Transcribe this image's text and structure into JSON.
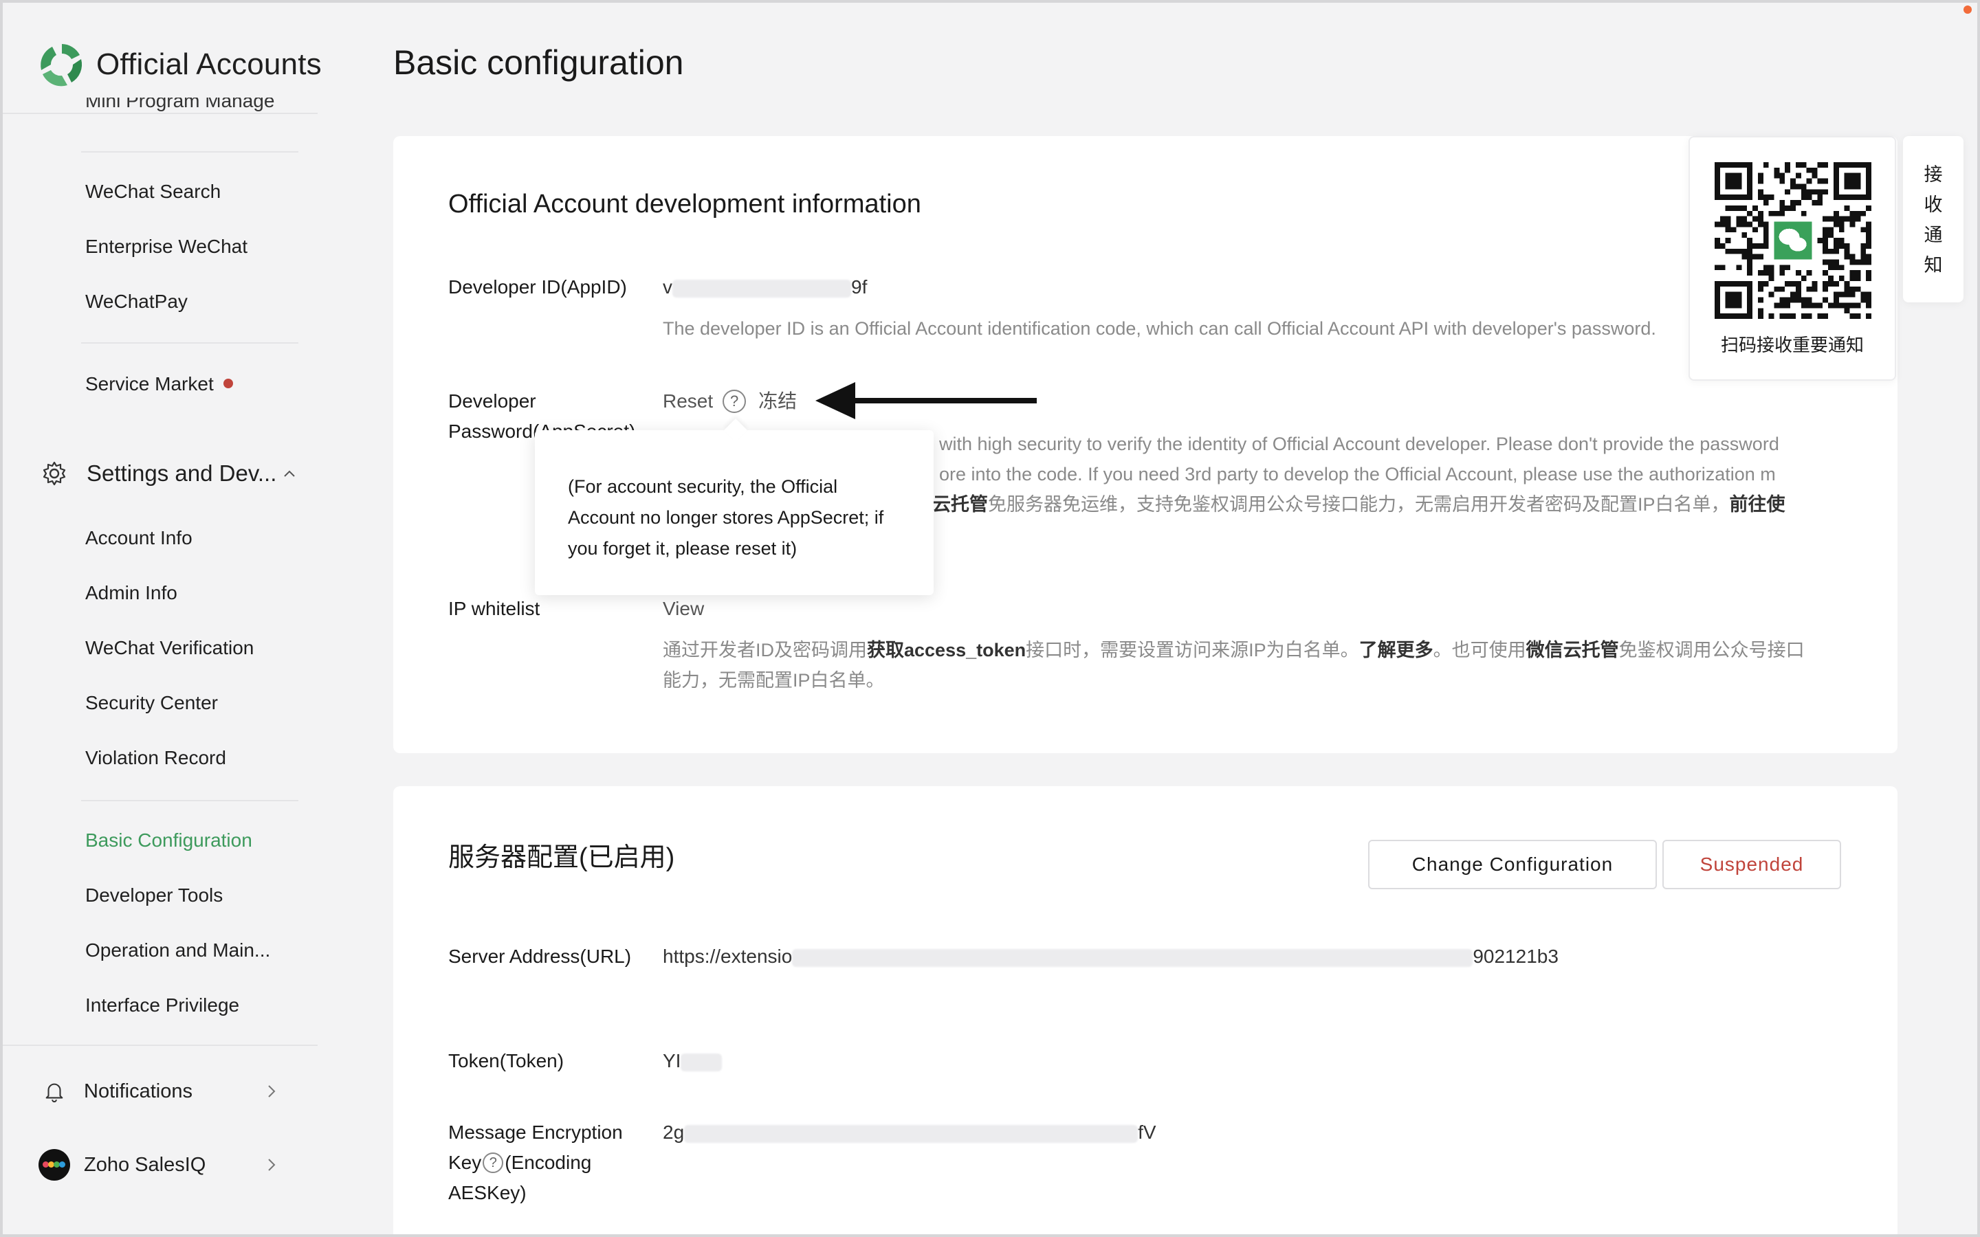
{
  "brand": {
    "name": "Official Accounts"
  },
  "sidebar": {
    "cut_item": "Mini Program Manage",
    "group1": [
      {
        "label": "WeChat Search"
      },
      {
        "label": "Enterprise WeChat"
      },
      {
        "label": "WeChatPay"
      }
    ],
    "service_market": {
      "label": "Service Market"
    },
    "settings_section": {
      "label": "Settings and Dev..."
    },
    "settings_items": [
      {
        "label": "Account Info"
      },
      {
        "label": "Admin Info"
      },
      {
        "label": "WeChat Verification"
      },
      {
        "label": "Security Center"
      },
      {
        "label": "Violation Record"
      }
    ],
    "dev_items": [
      {
        "label": "Basic Configuration"
      },
      {
        "label": "Developer Tools"
      },
      {
        "label": "Operation and Main..."
      },
      {
        "label": "Interface Privilege"
      }
    ],
    "notifications": {
      "label": "Notifications"
    },
    "account": {
      "label": "Zoho SalesIQ"
    }
  },
  "page": {
    "title": "Basic configuration"
  },
  "dev_info": {
    "title": "Official Account development information",
    "appid": {
      "label": "Developer ID(AppID)",
      "value_start": "v",
      "value_end": "9f",
      "desc": "The developer ID is an Official Account identification code, which can call Official Account API with developer's password."
    },
    "secret": {
      "label": "Developer Password(AppSecret)",
      "reset": "Reset",
      "help": "?",
      "freeze": "冻结",
      "desc_line1": "with high security to verify the identity of Official Account developer. Please don't provide the password",
      "desc_line2": "ore into the code. If you need 3rd party to develop the Official Account, please use the authorization m",
      "desc_line3_bold": "云托管",
      "desc_line3": "免服务器免运维，支持免鉴权调用公众号接口能力，无需启用开发者密码及配置IP白名单，",
      "desc_line3_tail": "前往使"
    },
    "tooltip": "(For account security, the Official Account no longer stores AppSecret; if you forget it, please reset it)",
    "ip": {
      "label": "IP whitelist",
      "action": "View",
      "desc_a": "通过开发者ID及密码调用",
      "desc_b": "获取access_token",
      "desc_c": "接口时，需要设置访问来源IP为白名单。",
      "desc_d": "了解更多",
      "desc_e": "。也可使用",
      "desc_f": "微信云托管",
      "desc_g": "免鉴权调用公众号接口",
      "desc_line2": "能力，无需配置IP白名单。"
    }
  },
  "qr_panel": {
    "caption": "扫码接收重要通知"
  },
  "notify_tab": {
    "chars": [
      "接",
      "收",
      "通",
      "知"
    ]
  },
  "server": {
    "title": "服务器配置(已启用)",
    "change_button": "Change Configuration",
    "suspend_button": "Suspended",
    "url": {
      "label": "Server Address(URL)",
      "value_start": "https://extensio",
      "value_end": "902121b3"
    },
    "token": {
      "label": "Token(Token)",
      "value_start": "YI"
    },
    "aes": {
      "label_a": "Message Encryption Key",
      "help": "?",
      "label_b": "(Encoding AESKey)",
      "value_start": "2g",
      "value_end": "fV"
    }
  },
  "colors": {
    "accent_green": "#3d9a5c",
    "alert_red": "#c0443b",
    "muted_text": "#8a8a8a"
  }
}
